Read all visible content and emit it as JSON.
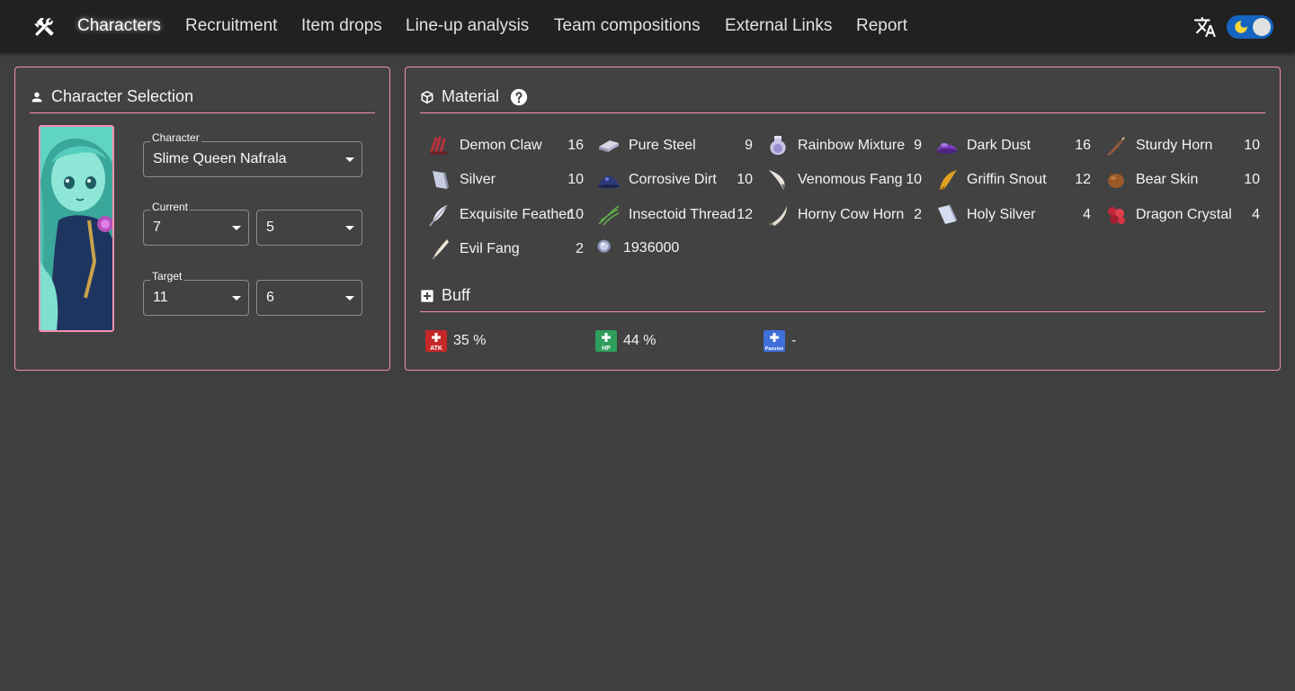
{
  "nav": {
    "items": [
      "Characters",
      "Recruitment",
      "Item drops",
      "Line-up analysis",
      "Team compositions",
      "External Links",
      "Report"
    ],
    "active": "Characters"
  },
  "selection": {
    "title": "Character Selection",
    "character_label": "Character",
    "character_value": "Slime Queen Nafrala",
    "current_label": "Current",
    "current_a": "7",
    "current_b": "5",
    "target_label": "Target",
    "target_a": "11",
    "target_b": "6"
  },
  "material": {
    "title": "Material",
    "items": [
      {
        "name": "Demon Claw",
        "qty": "16",
        "icon": "demon-claw-icon"
      },
      {
        "name": "Pure Steel",
        "qty": "9",
        "icon": "pure-steel-icon"
      },
      {
        "name": "Rainbow Mixture",
        "qty": "9",
        "icon": "rainbow-mixture-icon"
      },
      {
        "name": "Dark Dust",
        "qty": "16",
        "icon": "dark-dust-icon"
      },
      {
        "name": "Sturdy Horn",
        "qty": "10",
        "icon": "sturdy-horn-icon"
      },
      {
        "name": "Silver",
        "qty": "10",
        "icon": "silver-icon"
      },
      {
        "name": "Corrosive Dirt",
        "qty": "10",
        "icon": "corrosive-dirt-icon"
      },
      {
        "name": "Venomous Fang",
        "qty": "10",
        "icon": "venomous-fang-icon"
      },
      {
        "name": "Griffin Snout",
        "qty": "12",
        "icon": "griffin-snout-icon"
      },
      {
        "name": "Bear Skin",
        "qty": "10",
        "icon": "bear-skin-icon"
      },
      {
        "name": "Exquisite Feather",
        "qty": "10",
        "icon": "exquisite-feather-icon"
      },
      {
        "name": "Insectoid Thread",
        "qty": "12",
        "icon": "insectoid-thread-icon"
      },
      {
        "name": "Horny Cow Horn",
        "qty": "2",
        "icon": "horny-cow-horn-icon"
      },
      {
        "name": "Holy Silver",
        "qty": "4",
        "icon": "holy-silver-icon"
      },
      {
        "name": "Dragon Crystal",
        "qty": "4",
        "icon": "dragon-crystal-icon"
      },
      {
        "name": "Evil Fang",
        "qty": "2",
        "icon": "evil-fang-icon"
      }
    ],
    "coins": "1936000"
  },
  "buff": {
    "title": "Buff",
    "atk": "35 %",
    "hp": "44 %",
    "passive": "-"
  },
  "colors": {
    "accent": "#f48fb1",
    "panel": "#424242",
    "background": "#3f3f3f",
    "topbar": "#212121",
    "toggle": "#1565c0"
  }
}
